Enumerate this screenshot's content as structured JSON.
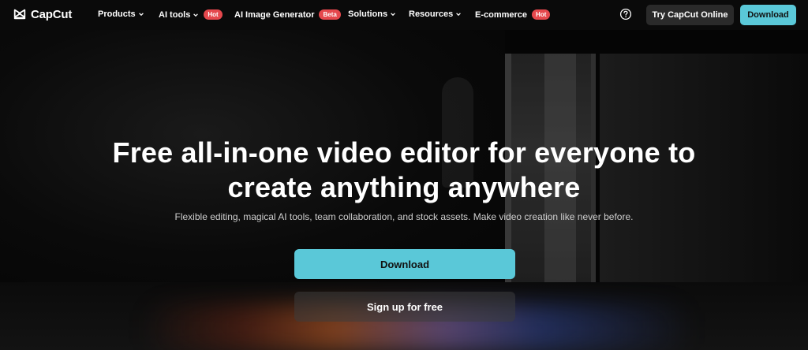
{
  "nav": {
    "logo_text": "CapCut",
    "items": [
      {
        "label": "Products",
        "chevron": true
      },
      {
        "label": "AI tools",
        "chevron": true,
        "badge": "Hot"
      },
      {
        "label": "AI Image Generator",
        "badge": "Beta"
      },
      {
        "label": "Solutions",
        "chevron": true
      },
      {
        "label": "Resources",
        "chevron": true
      },
      {
        "label": "E-commerce",
        "badge": "Hot"
      }
    ],
    "help_icon": "question-circle-icon",
    "try_online_label": "Try CapCut Online",
    "download_label": "Download"
  },
  "hero": {
    "headline_line1": "Free all-in-one video editor for everyone to",
    "headline_line2": "create anything anywhere",
    "subheadline": "Flexible editing, magical AI tools, team collaboration, and stock assets. Make video creation like never before.",
    "download_label": "Download",
    "signup_label": "Sign up for free"
  },
  "colors": {
    "accent": "#5ac8d8",
    "badge_hot": "#e5484d",
    "badge_beta": "#e5484d",
    "nav_bg": "#0a0a0a"
  }
}
